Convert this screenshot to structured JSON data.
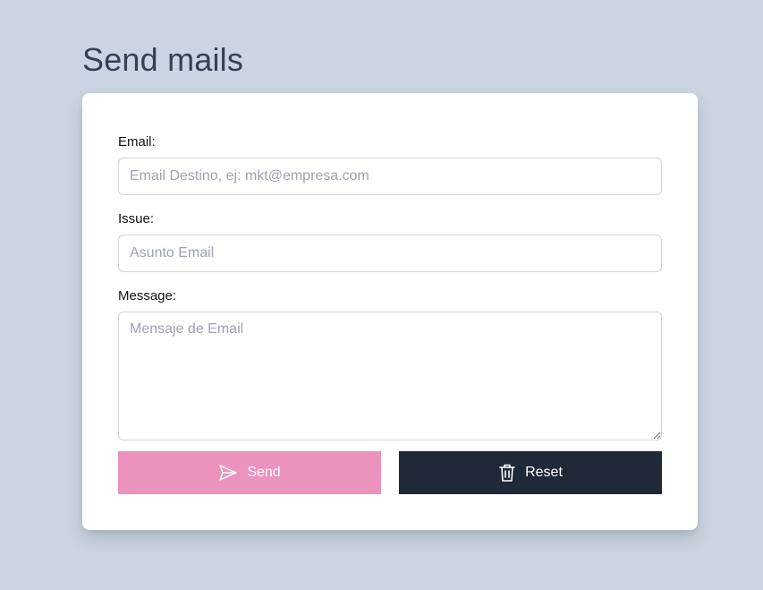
{
  "page": {
    "title": "Send mails"
  },
  "form": {
    "email": {
      "label": "Email:",
      "value": "",
      "placeholder": "Email Destino, ej: mkt@empresa.com"
    },
    "issue": {
      "label": "Issue:",
      "value": "",
      "placeholder": "Asunto Email"
    },
    "message": {
      "label": "Message:",
      "value": "",
      "placeholder": "Mensaje de Email"
    },
    "buttons": {
      "send": {
        "label": "Send",
        "icon": "paper-plane-icon",
        "color": "#ec93bd"
      },
      "reset": {
        "label": "Reset",
        "icon": "trash-icon",
        "color": "#1f2937"
      }
    }
  },
  "colors": {
    "background": "#cbd5e1",
    "card": "#ffffff",
    "title": "#334155"
  }
}
